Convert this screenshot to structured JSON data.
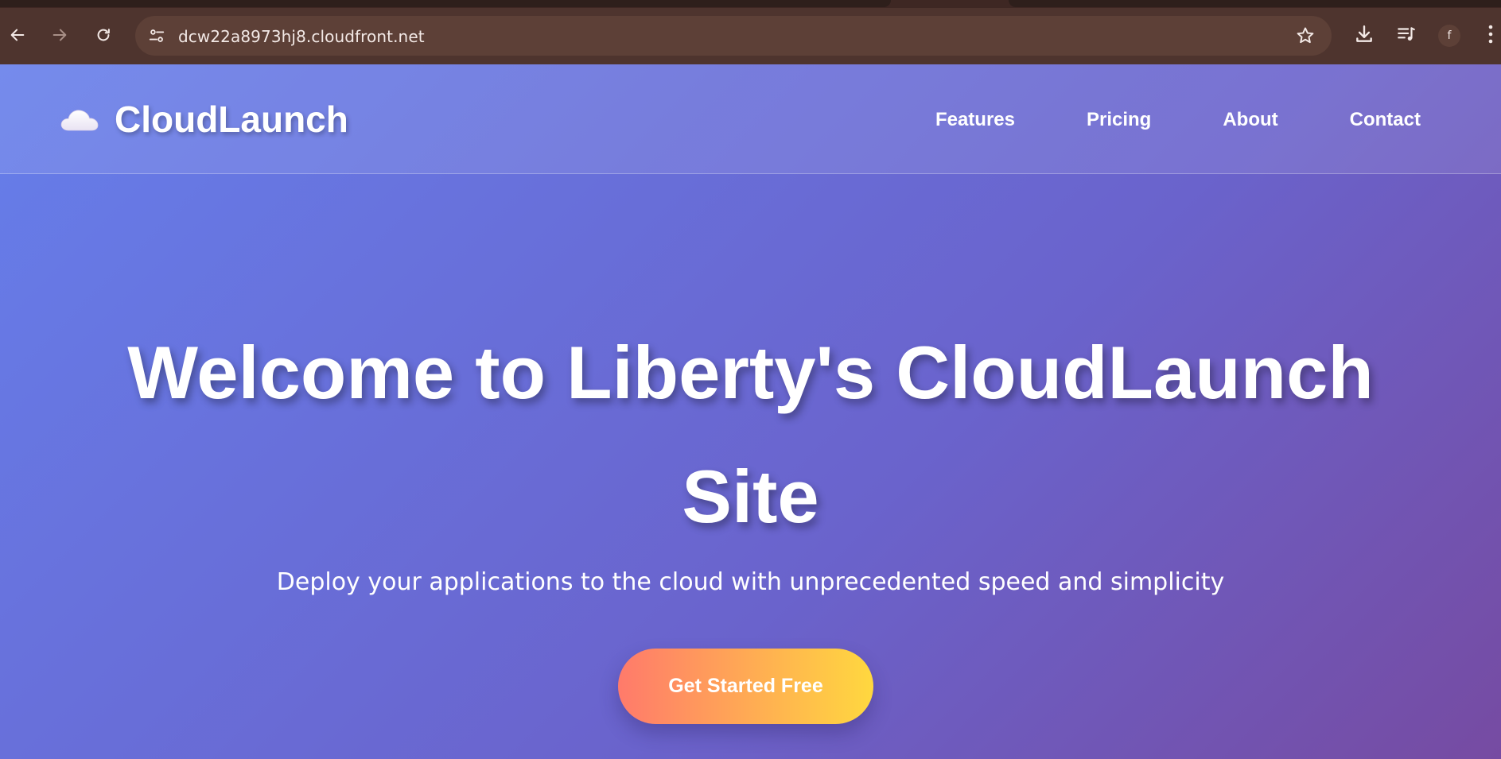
{
  "browser": {
    "url": "dcw22a8973hj8.cloudfront.net",
    "profile_initial": "f",
    "icons": {
      "back": "back-arrow-icon",
      "forward": "forward-arrow-icon",
      "reload": "reload-icon",
      "site_info": "site-settings-icon",
      "bookmark": "star-icon",
      "downloads": "download-icon",
      "media": "media-queue-icon",
      "menu": "kebab-menu-icon"
    }
  },
  "site": {
    "logo_icon": "cloud-icon",
    "logo_text": "CloudLaunch",
    "nav": [
      {
        "label": "Features"
      },
      {
        "label": "Pricing"
      },
      {
        "label": "About"
      },
      {
        "label": "Contact"
      }
    ]
  },
  "hero": {
    "title": "Welcome to Liberty's CloudLaunch Site",
    "subtitle": "Deploy your applications to the cloud with unprecedented speed and simplicity",
    "cta_label": "Get Started Free"
  },
  "colors": {
    "chrome_bg": "#4e342e",
    "omnibox_bg": "#5d4037",
    "gradient_start": "#667eea",
    "gradient_end": "#764ba2",
    "cta_start": "#ff7a6b",
    "cta_end": "#ffd83f"
  }
}
